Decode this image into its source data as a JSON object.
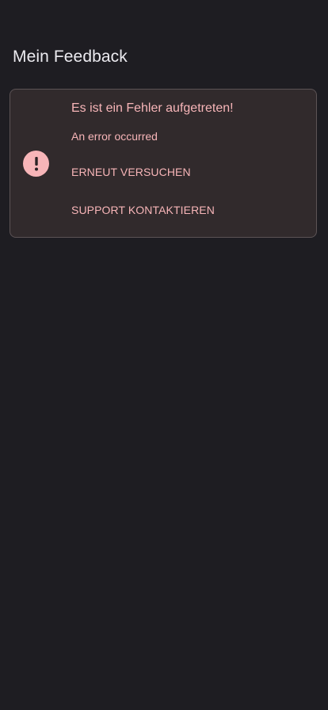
{
  "header": {
    "title": "Mein Feedback"
  },
  "error_card": {
    "icon": "alert-circle-icon",
    "title": "Es ist ein Fehler aufgetreten!",
    "message": "An error occurred",
    "retry_label": "ERNEUT VERSUCHEN",
    "support_label": "SUPPORT KONTAKTIEREN"
  },
  "colors": {
    "background": "#1e1d22",
    "card_background": "#312a2c",
    "card_border": "#5c5355",
    "error_accent": "#f7b5b8",
    "title_text": "#ecebf0"
  }
}
